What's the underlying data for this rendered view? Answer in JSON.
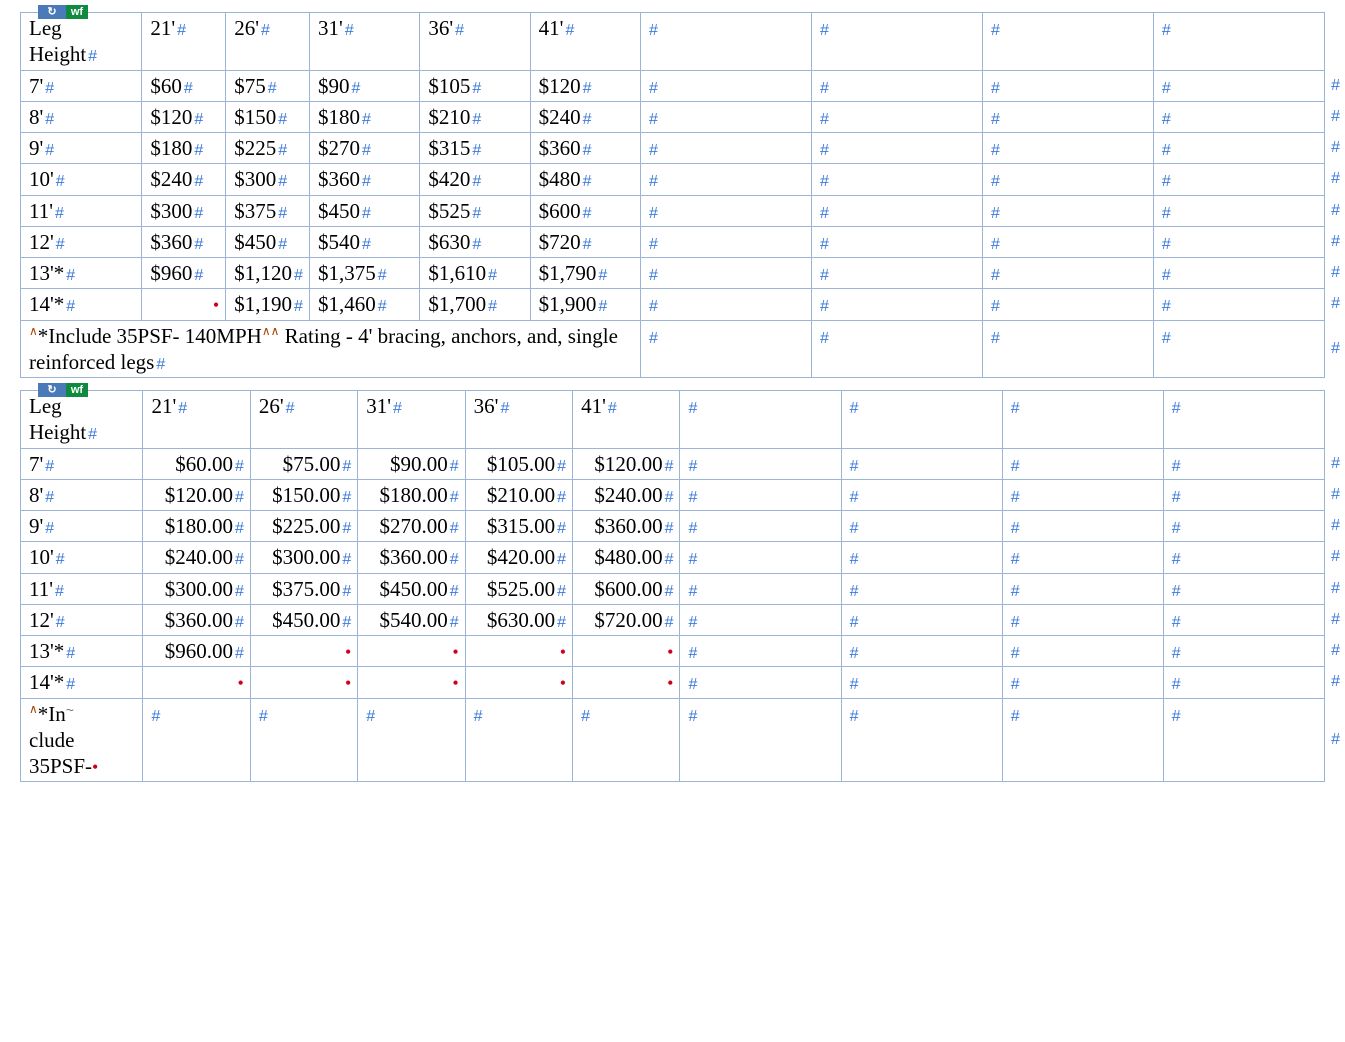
{
  "badge": {
    "left": "↻",
    "right": "wf"
  },
  "marks": {
    "cell": "#",
    "rowend": "#",
    "dot": "•"
  },
  "table1": {
    "header": [
      "Leg Height",
      "21'",
      "26'",
      "31'",
      "36'",
      "41'",
      "",
      "",
      "",
      ""
    ],
    "rows": [
      [
        "7'",
        "$60",
        "$75",
        "$90",
        "$105",
        "$120",
        "",
        "",
        "",
        ""
      ],
      [
        "8'",
        "$120",
        "$150",
        "$180",
        "$210",
        "$240",
        "",
        "",
        "",
        ""
      ],
      [
        "9'",
        "$180",
        "$225",
        "$270",
        "$315",
        "$360",
        "",
        "",
        "",
        ""
      ],
      [
        "10'",
        "$240",
        "$300",
        "$360",
        "$420",
        "$480",
        "",
        "",
        "",
        ""
      ],
      [
        "11'",
        "$300",
        "$375",
        "$450",
        "$525",
        "$600",
        "",
        "",
        "",
        ""
      ],
      [
        "12'",
        "$360",
        "$450",
        "$540",
        "$630",
        "$720",
        "",
        "",
        "",
        ""
      ],
      [
        "13'*",
        "$960",
        "$1,120",
        "$1,375",
        "$1,610",
        "$1,790",
        "",
        "",
        "",
        ""
      ],
      [
        "14'*",
        "",
        "$1,190",
        "$1,460",
        "$1,700",
        "$1,900",
        "",
        "",
        "",
        ""
      ]
    ],
    "dots_row": 7,
    "dots_cols": [
      1
    ],
    "footnote": {
      "text": "*Include 35PSF- 140MPH   Rating - 4' bracing, anchors, and, single reinforced legs",
      "span": 6,
      "tail_cells": 4
    }
  },
  "table2": {
    "header": [
      "Leg Height",
      "21'",
      "26'",
      "31'",
      "36'",
      "41'",
      "",
      "",
      "",
      ""
    ],
    "rows": [
      [
        "7'",
        "$60.00",
        "$75.00",
        "$90.00",
        "$105.00",
        "$120.00",
        "",
        "",
        "",
        ""
      ],
      [
        "8'",
        "$120.00",
        "$150.00",
        "$180.00",
        "$210.00",
        "$240.00",
        "",
        "",
        "",
        ""
      ],
      [
        "9'",
        "$180.00",
        "$225.00",
        "$270.00",
        "$315.00",
        "$360.00",
        "",
        "",
        "",
        ""
      ],
      [
        "10'",
        "$240.00",
        "$300.00",
        "$360.00",
        "$420.00",
        "$480.00",
        "",
        "",
        "",
        ""
      ],
      [
        "11'",
        "$300.00",
        "$375.00",
        "$450.00",
        "$525.00",
        "$600.00",
        "",
        "",
        "",
        ""
      ],
      [
        "12'",
        "$360.00",
        "$450.00",
        "$540.00",
        "$630.00",
        "$720.00",
        "",
        "",
        "",
        ""
      ],
      [
        "13'*",
        "$960.00",
        "",
        "",
        "",
        "",
        "",
        "",
        "",
        ""
      ],
      [
        "14'*",
        "",
        "",
        "",
        "",
        "",
        "",
        "",
        "",
        ""
      ]
    ],
    "dots": {
      "6": [
        2,
        3,
        4,
        5
      ],
      "7": [
        1,
        2,
        3,
        4,
        5
      ]
    },
    "footnote": {
      "text": "*Include 35PSF-",
      "span": 1,
      "tail_cells": 9,
      "trailing_dot": true
    }
  },
  "chart_data": [
    {
      "type": "table",
      "title": "Leg Height Pricing (Table 1)",
      "columns": [
        "Leg Height",
        "21'",
        "26'",
        "31'",
        "36'",
        "41'"
      ],
      "rows": [
        {
          "leg_height": "7'",
          "21'": 60,
          "26'": 75,
          "31'": 90,
          "36'": 105,
          "41'": 120
        },
        {
          "leg_height": "8'",
          "21'": 120,
          "26'": 150,
          "31'": 180,
          "36'": 210,
          "41'": 240
        },
        {
          "leg_height": "9'",
          "21'": 180,
          "26'": 225,
          "31'": 270,
          "36'": 315,
          "41'": 360
        },
        {
          "leg_height": "10'",
          "21'": 240,
          "26'": 300,
          "31'": 360,
          "36'": 420,
          "41'": 480
        },
        {
          "leg_height": "11'",
          "21'": 300,
          "26'": 375,
          "31'": 450,
          "36'": 525,
          "41'": 600
        },
        {
          "leg_height": "12'",
          "21'": 360,
          "26'": 450,
          "31'": 540,
          "36'": 630,
          "41'": 720
        },
        {
          "leg_height": "13'*",
          "21'": 960,
          "26'": 1120,
          "31'": 1375,
          "36'": 1610,
          "41'": 1790
        },
        {
          "leg_height": "14'*",
          "21'": null,
          "26'": 1190,
          "31'": 1460,
          "36'": 1700,
          "41'": 1900
        }
      ],
      "footnote": "*Include 35PSF- 140MPH Rating - 4' bracing, anchors, and, single reinforced legs"
    },
    {
      "type": "table",
      "title": "Leg Height Pricing (Table 2)",
      "columns": [
        "Leg Height",
        "21'",
        "26'",
        "31'",
        "36'",
        "41'"
      ],
      "rows": [
        {
          "leg_height": "7'",
          "21'": 60.0,
          "26'": 75.0,
          "31'": 90.0,
          "36'": 105.0,
          "41'": 120.0
        },
        {
          "leg_height": "8'",
          "21'": 120.0,
          "26'": 150.0,
          "31'": 180.0,
          "36'": 210.0,
          "41'": 240.0
        },
        {
          "leg_height": "9'",
          "21'": 180.0,
          "26'": 225.0,
          "31'": 270.0,
          "36'": 315.0,
          "41'": 360.0
        },
        {
          "leg_height": "10'",
          "21'": 240.0,
          "26'": 300.0,
          "31'": 360.0,
          "36'": 420.0,
          "41'": 480.0
        },
        {
          "leg_height": "11'",
          "21'": 300.0,
          "26'": 375.0,
          "31'": 450.0,
          "36'": 525.0,
          "41'": 600.0
        },
        {
          "leg_height": "12'",
          "21'": 360.0,
          "26'": 450.0,
          "31'": 540.0,
          "36'": 630.0,
          "41'": 720.0
        },
        {
          "leg_height": "13'*",
          "21'": 960.0,
          "26'": null,
          "31'": null,
          "36'": null,
          "41'": null
        },
        {
          "leg_height": "14'*",
          "21'": null,
          "26'": null,
          "31'": null,
          "36'": null,
          "41'": null
        }
      ],
      "footnote": "*Include 35PSF-"
    }
  ]
}
